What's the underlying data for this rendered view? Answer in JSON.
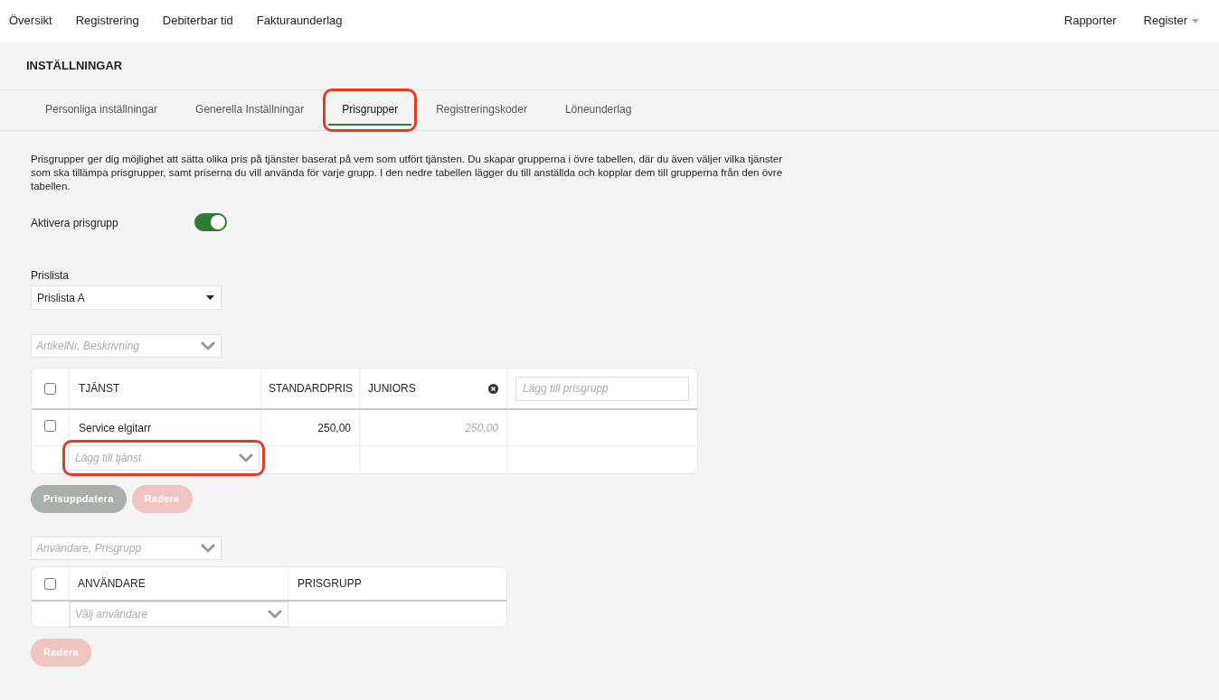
{
  "nav": {
    "left": [
      {
        "label": "Översikt"
      },
      {
        "label": "Registrering"
      },
      {
        "label": "Debiterbar tid"
      },
      {
        "label": "Fakturaunderlag"
      }
    ],
    "right": [
      {
        "label": "Rapporter",
        "dropdown": false
      },
      {
        "label": "Register",
        "dropdown": true
      }
    ]
  },
  "page_title": "INSTÄLLNINGAR",
  "tabs": [
    {
      "label": "Personliga inställningar",
      "selected": false,
      "highlighted": false
    },
    {
      "label": "Generella Inställningar",
      "selected": false,
      "highlighted": false
    },
    {
      "label": "Prisgrupper",
      "selected": true,
      "highlighted": true
    },
    {
      "label": "Registreringskoder",
      "selected": false,
      "highlighted": false
    },
    {
      "label": "Löneunderlag",
      "selected": false,
      "highlighted": false
    }
  ],
  "description": "Prisgrupper ger dig möjlighet att sätta olika pris på tjänster baserat på vem som utfört tjänsten. Du skapar grupperna i övre tabellen, där du även väljer vilka tjänster som ska tillämpa prisgrupper, samt priserna du vill använda för varje grupp. I den nedre tabellen lägger du till anställda och kopplar dem till grupperna från den övre tabellen.",
  "activate": {
    "label": "Aktivera prisgrupp",
    "on": true
  },
  "pricelist": {
    "label": "Prislista",
    "value": "Prislista A"
  },
  "service_search": {
    "placeholder": "ArtikelNr, Beskrivning"
  },
  "services_table": {
    "header_checked": false,
    "columns": [
      {
        "label": "TJÄNST"
      },
      {
        "label": "STANDARDPRIS"
      },
      {
        "label": "JUNIORS",
        "removable": true
      }
    ],
    "add_group_placeholder": "Lägg till prisgrupp",
    "rows": [
      {
        "checked": false,
        "service": "Service elgitarr",
        "standard_price": "250,00",
        "juniors": "250,00"
      }
    ],
    "add_service": {
      "placeholder": "Lägg till tjänst",
      "highlighted": true
    }
  },
  "services_buttons": [
    {
      "label": "Prisuppdatera",
      "kind": "update",
      "disabled": true
    },
    {
      "label": "Radera",
      "kind": "delete",
      "disabled": true
    }
  ],
  "user_search": {
    "placeholder": "Användare, Prisgrupp"
  },
  "users_table": {
    "header_checked": false,
    "columns": [
      {
        "label": "ANVÄNDARE"
      },
      {
        "label": "PRISGRUPP"
      }
    ],
    "add_user_placeholder": "Välj användare"
  },
  "users_buttons": [
    {
      "label": "Radera",
      "kind": "delete",
      "disabled": true
    }
  ]
}
